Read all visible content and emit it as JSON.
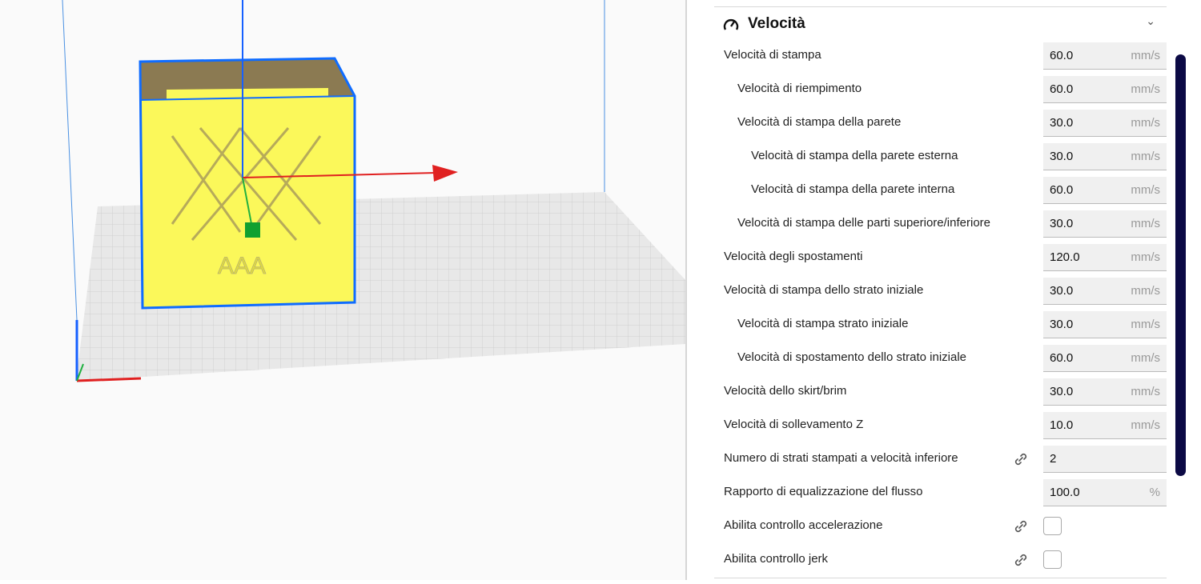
{
  "section": {
    "title": "Velocità",
    "icon": "speedometer-icon"
  },
  "settings": [
    {
      "label": "Velocità di stampa",
      "value": "60.0",
      "unit": "mm/s",
      "indent": 0
    },
    {
      "label": "Velocità di riempimento",
      "value": "60.0",
      "unit": "mm/s",
      "indent": 1
    },
    {
      "label": "Velocità di stampa della parete",
      "value": "30.0",
      "unit": "mm/s",
      "indent": 1
    },
    {
      "label": "Velocità di stampa della parete esterna",
      "value": "30.0",
      "unit": "mm/s",
      "indent": 2
    },
    {
      "label": "Velocità di stampa della parete interna",
      "value": "60.0",
      "unit": "mm/s",
      "indent": 2
    },
    {
      "label": "Velocità di stampa delle parti superiore/inferiore",
      "value": "30.0",
      "unit": "mm/s",
      "indent": 1
    },
    {
      "label": "Velocità degli spostamenti",
      "value": "120.0",
      "unit": "mm/s",
      "indent": 0
    },
    {
      "label": "Velocità di stampa dello strato iniziale",
      "value": "30.0",
      "unit": "mm/s",
      "indent": 0
    },
    {
      "label": "Velocità di stampa strato iniziale",
      "value": "30.0",
      "unit": "mm/s",
      "indent": 1
    },
    {
      "label": "Velocità di spostamento dello strato iniziale",
      "value": "60.0",
      "unit": "mm/s",
      "indent": 1
    },
    {
      "label": "Velocità dello skirt/brim",
      "value": "30.0",
      "unit": "mm/s",
      "indent": 0
    },
    {
      "label": "Velocità di sollevamento Z",
      "value": "10.0",
      "unit": "mm/s",
      "indent": 0
    },
    {
      "label": "Numero di strati stampati a velocità inferiore",
      "value": "2",
      "unit": "",
      "indent": 0,
      "linked": true
    },
    {
      "label": "Rapporto di equalizzazione del flusso",
      "value": "100.0",
      "unit": "%",
      "indent": 0
    },
    {
      "label": "Abilita controllo accelerazione",
      "checkbox": true,
      "checked": false,
      "indent": 0,
      "linked": true
    },
    {
      "label": "Abilita controllo jerk",
      "checkbox": true,
      "checked": false,
      "indent": 0,
      "linked": true
    }
  ],
  "model": {
    "text": "AAA"
  },
  "colors": {
    "model": "#fbf85a",
    "selection": "#0f6cff",
    "scrollbar": "#0c0a45"
  }
}
